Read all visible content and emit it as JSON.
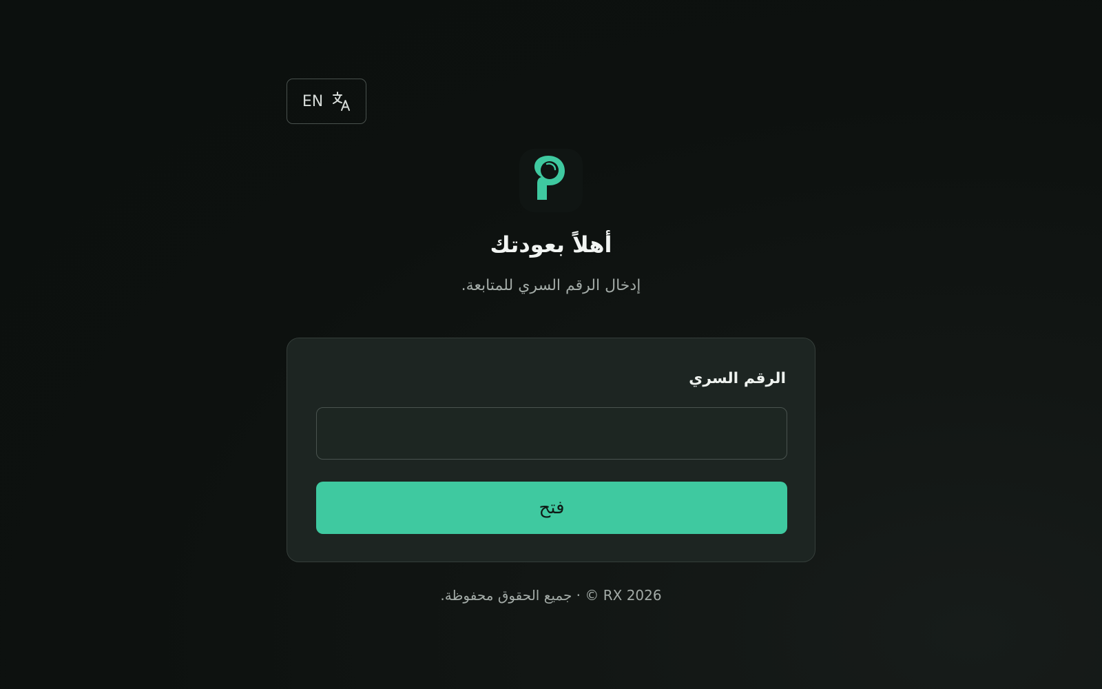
{
  "language_toggle": {
    "label": "EN",
    "icon": "translate-icon"
  },
  "logo": {
    "icon": "brand-logo-icon",
    "color": "#3fc9a0"
  },
  "header": {
    "title": "أهلاً بعودتك",
    "subtitle": "إدخال الرقم السري للمتابعة."
  },
  "form": {
    "pin_label": "الرقم السري",
    "pin_value": "",
    "submit_label": "فتح"
  },
  "footer": {
    "text": "RX 2026 © · جميع الحقوق محفوظة."
  },
  "colors": {
    "accent": "#3fc9a0",
    "background": "#0d110f",
    "card": "#1d2522"
  }
}
